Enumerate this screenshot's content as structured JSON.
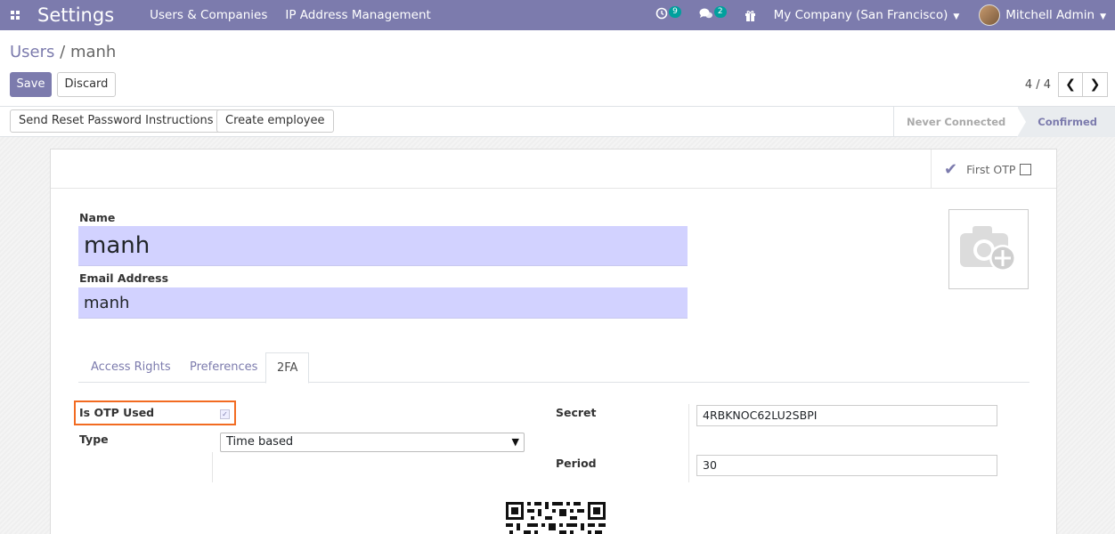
{
  "navbar": {
    "app_title": "Settings",
    "menu": [
      "Users & Companies",
      "IP Address Management"
    ],
    "activity_badge": "9",
    "messages_badge": "2",
    "company": "My Company (San Francisco)",
    "user": "Mitchell Admin",
    "accent": "#7c7bad"
  },
  "control": {
    "breadcrumb_parent": "Users",
    "breadcrumb_sep": "/",
    "breadcrumb_current": "manh",
    "save_label": "Save",
    "discard_label": "Discard",
    "pager": "4 / 4"
  },
  "statusbar": {
    "reset_password_label": "Send Reset Password Instructions",
    "create_employee_label": "Create employee",
    "stages": [
      "Never Connected",
      "Confirmed"
    ],
    "active_stage": "Confirmed"
  },
  "form": {
    "first_otp_label": "First OTP",
    "name_label": "Name",
    "name_value": "manh",
    "email_label": "Email Address",
    "email_value": "manh",
    "tabs": [
      "Access Rights",
      "Preferences",
      "2FA"
    ],
    "active_tab": "2FA",
    "otp_used_label": "Is OTP Used",
    "otp_used_checked": true,
    "type_label": "Type",
    "type_value": "Time based",
    "secret_label": "Secret",
    "secret_value": "4RBKNOC62LU2SBPI",
    "period_label": "Period",
    "period_value": "30",
    "highlight_color": "#f26b21"
  }
}
